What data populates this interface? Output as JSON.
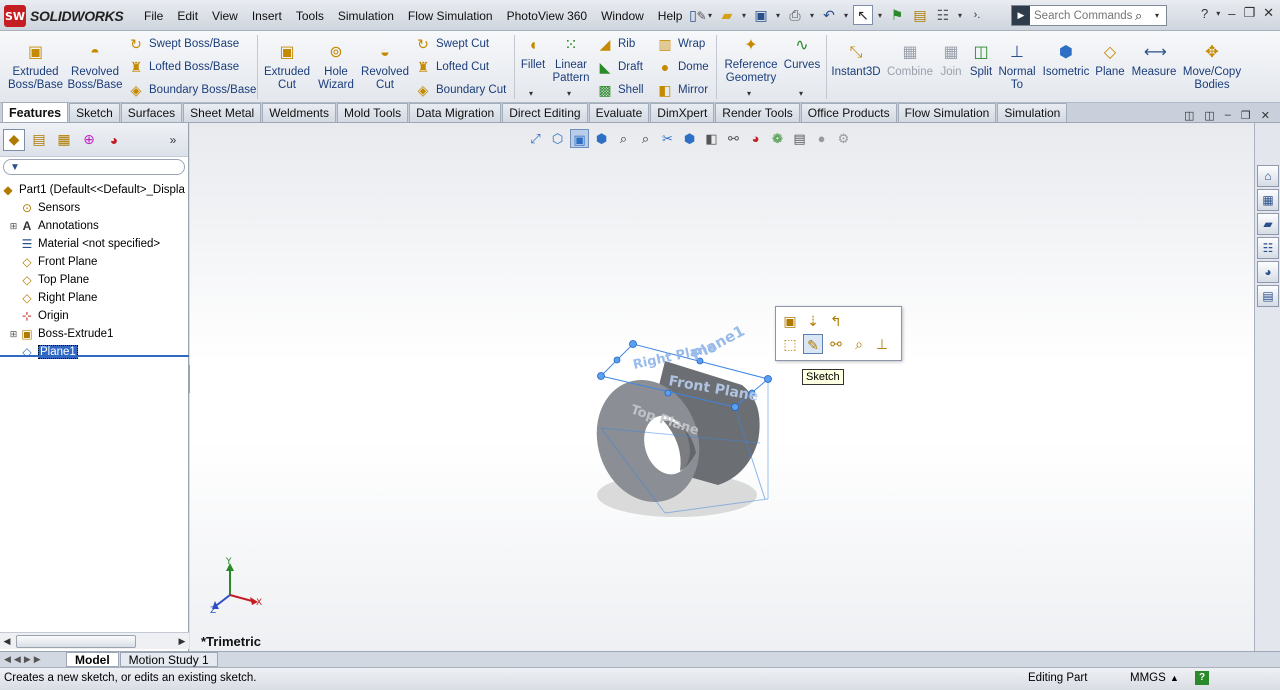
{
  "app": {
    "logo_badge": "SW",
    "logo_text": "SOLIDWORKS"
  },
  "menu": [
    "File",
    "Edit",
    "View",
    "Insert",
    "Tools",
    "Simulation",
    "Flow Simulation",
    "PhotoView 360",
    "Window",
    "Help"
  ],
  "search": {
    "placeholder": "Search Commands"
  },
  "ribbon": {
    "extruded_boss": "Extruded\nBoss/Base",
    "revolved_boss": "Revolved\nBoss/Base",
    "swept_boss": "Swept Boss/Base",
    "lofted_boss": "Lofted Boss/Base",
    "boundary_boss": "Boundary Boss/Base",
    "extruded_cut": "Extruded\nCut",
    "hole_wizard": "Hole\nWizard",
    "revolved_cut": "Revolved\nCut",
    "swept_cut": "Swept Cut",
    "lofted_cut": "Lofted Cut",
    "boundary_cut": "Boundary Cut",
    "fillet": "Fillet",
    "linear_pattern": "Linear\nPattern",
    "rib": "Rib",
    "draft": "Draft",
    "shell": "Shell",
    "wrap": "Wrap",
    "dome": "Dome",
    "mirror": "Mirror",
    "reference_geometry": "Reference\nGeometry",
    "curves": "Curves",
    "instant3d": "Instant3D",
    "combine": "Combine",
    "join": "Join",
    "split": "Split",
    "normal_to": "Normal\nTo",
    "isometric": "Isometric",
    "plane": "Plane",
    "measure": "Measure",
    "move_copy": "Move/Copy\nBodies"
  },
  "tabs": [
    "Features",
    "Sketch",
    "Surfaces",
    "Sheet Metal",
    "Weldments",
    "Mold Tools",
    "Data Migration",
    "Direct Editing",
    "Evaluate",
    "DimXpert",
    "Render Tools",
    "Office Products",
    "Flow Simulation",
    "Simulation"
  ],
  "tree": {
    "root": "Part1  (Default<<Default>_Displa",
    "items": [
      "Sensors",
      "Annotations",
      "Material <not specified>",
      "Front Plane",
      "Top Plane",
      "Right Plane",
      "Origin",
      "Boss-Extrude1",
      "Plane1"
    ]
  },
  "graphics": {
    "view_label": "*Trimetric",
    "tooltip": "Sketch",
    "triad_x": "X",
    "triad_y": "Y",
    "triad_z": "Z",
    "plane_label_1": "Plane1",
    "plane_label_2": "Right Plane",
    "plane_label_3": "Top Plane",
    "plane_label_4": "Front Plane"
  },
  "bottom_tabs": [
    "Model",
    "Motion Study 1"
  ],
  "status": {
    "message": "Creates a new sketch, or edits an existing sketch.",
    "mode": "Editing Part",
    "units": "MMGS",
    "help": "?"
  },
  "colors": {
    "accent": "#3168c4",
    "brand": "#c41e24"
  }
}
